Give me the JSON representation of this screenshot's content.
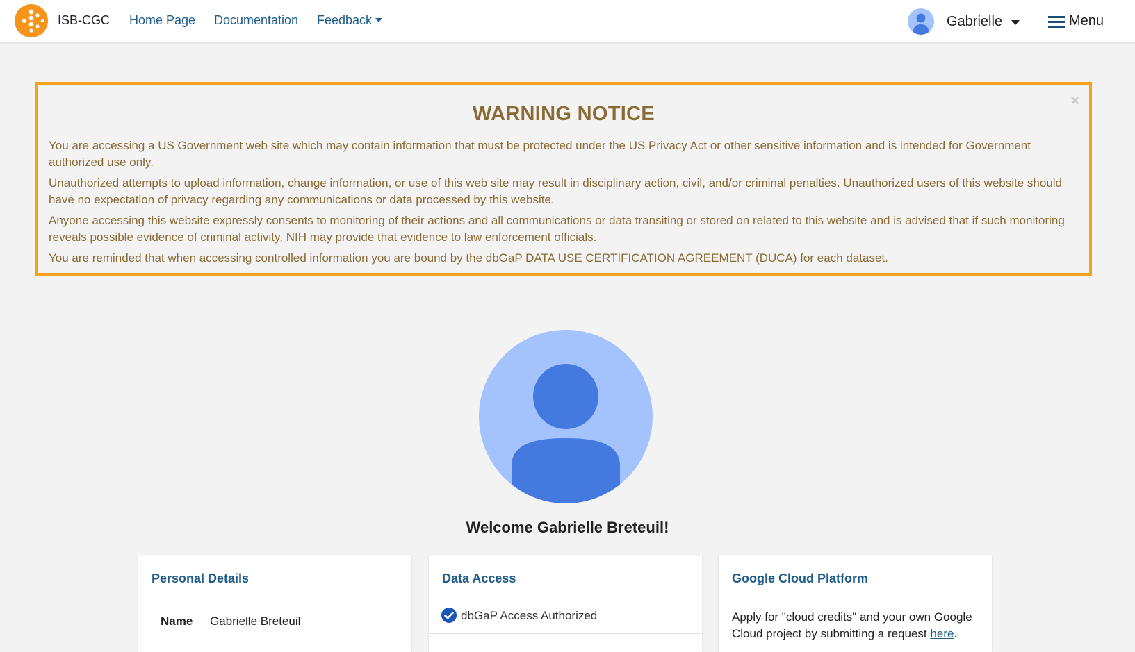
{
  "navbar": {
    "brand_name": "ISB-CGC",
    "links": {
      "home": "Home Page",
      "documentation": "Documentation",
      "feedback": "Feedback"
    },
    "user_name": "Gabrielle",
    "menu_label": "Menu"
  },
  "warning": {
    "close_glyph": "×",
    "title": "WARNING NOTICE",
    "paragraphs": [
      "You are accessing a US Government web site which may contain information that must be protected under the US Privacy Act or other sensitive information and is intended for Government authorized use only.",
      "Unauthorized attempts to upload information, change information, or use of this web site may result in disciplinary action, civil, and/or criminal penalties. Unauthorized users of this website should have no expectation of privacy regarding any communications or data processed by this website.",
      "Anyone accessing this website expressly consents to monitoring of their actions and all communications or data transiting or stored on related to this website and is advised that if such monitoring reveals possible evidence of criminal activity, NIH may provide that evidence to law enforcement officials.",
      "You are reminded that when accessing controlled information you are bound by the dbGaP DATA USE CERTIFICATION AGREEMENT (DUCA) for each dataset."
    ]
  },
  "profile": {
    "welcome": "Welcome Gabrielle Breteuil!"
  },
  "cards": {
    "personal": {
      "title": "Personal Details",
      "name_label": "Name",
      "name_value": "Gabrielle Breteuil"
    },
    "data_access": {
      "title": "Data Access",
      "status": "dbGaP Access Authorized"
    },
    "gcp": {
      "title": "Google Cloud Platform",
      "text": "Apply for \"cloud credits\" and your own Google Cloud project by submitting a request",
      "link_text": "here",
      "suffix": "."
    }
  },
  "colors": {
    "brand_orange": "#f6a11c",
    "link_blue": "#1f5c8a",
    "warning_text": "#8a6b36",
    "avatar_light": "#a4c2fb",
    "avatar_dark": "#4479e0"
  },
  "icons": [
    "isb-cgc-logo",
    "user-avatar-icon",
    "menu-icon",
    "close-icon",
    "profile-avatar",
    "check-circle-icon"
  ]
}
